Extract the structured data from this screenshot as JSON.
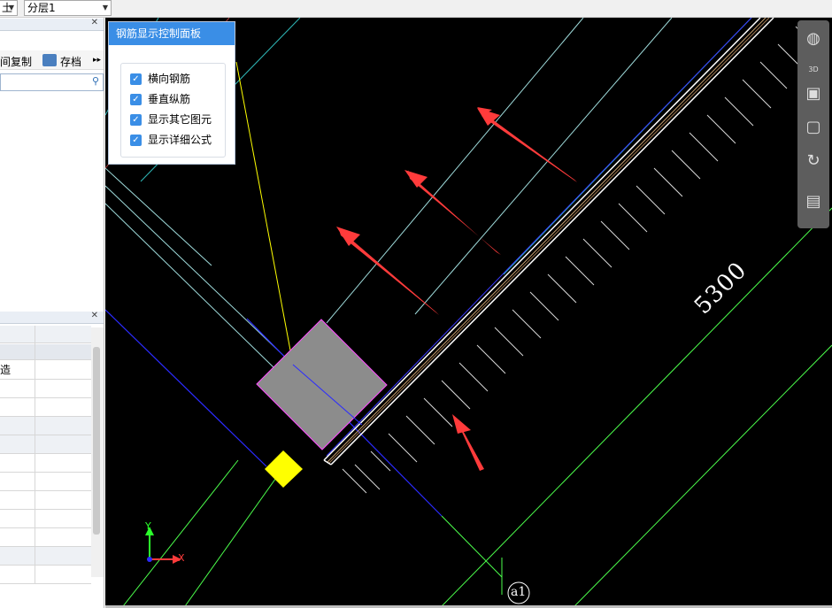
{
  "topbar": {
    "select_left": "土",
    "select_floor": "分层1"
  },
  "left_panel": {
    "toolbar": {
      "copy_label": "间复制",
      "save_label": "存档",
      "more": "▸▸"
    },
    "grid_rows": [
      "造",
      "",
      "",
      "",
      "",
      "",
      "",
      "",
      "",
      "",
      "",
      ""
    ]
  },
  "control_panel": {
    "title": "钢筋显示控制面板",
    "options": [
      {
        "label": "横向钢筋",
        "checked": true
      },
      {
        "label": "垂直纵筋",
        "checked": true
      },
      {
        "label": "显示其它图元",
        "checked": true
      },
      {
        "label": "显示详细公式",
        "checked": true
      }
    ]
  },
  "cad": {
    "dimension_text": "5300",
    "axis_label": "a1",
    "axis_x": "X",
    "axis_y": "Y",
    "colors": {
      "background": "#000000",
      "arrow": "#ff3b3b",
      "gridline": "#4cff4c",
      "section_gray": "#8c8c8c",
      "marker_yellow": "#ffff00",
      "blue_line": "#2b2bff"
    }
  },
  "view_toolbar": {
    "icons": [
      "sphere-icon",
      "3d-cube-icon",
      "cube-front-icon",
      "cube-side-icon",
      "rotate-icon",
      "layout-icon"
    ],
    "cube_3d_label": "3D"
  }
}
